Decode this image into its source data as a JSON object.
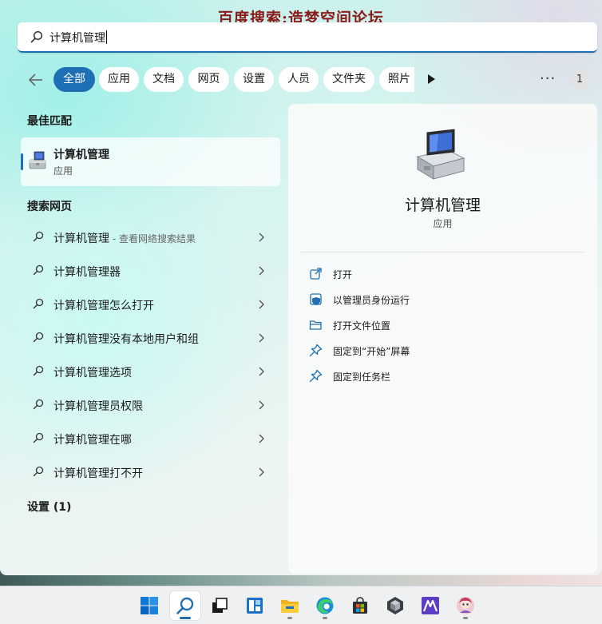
{
  "watermark": "百度搜索:造梦空间论坛",
  "search": {
    "value": "计算机管理"
  },
  "filters": {
    "tabs": [
      {
        "label": "全部",
        "active": true
      },
      {
        "label": "应用"
      },
      {
        "label": "文档"
      },
      {
        "label": "网页"
      },
      {
        "label": "设置"
      },
      {
        "label": "人员"
      },
      {
        "label": "文件夹"
      },
      {
        "label": "照片"
      }
    ],
    "more": "···",
    "badge": "1"
  },
  "best_match": {
    "heading": "最佳匹配",
    "name": "计算机管理",
    "type": "应用"
  },
  "web": {
    "heading": "搜索网页",
    "items": [
      {
        "label": "计算机管理",
        "sub": " - 查看网络搜索结果"
      },
      {
        "label": "计算机管理器"
      },
      {
        "label": "计算机管理怎么打开"
      },
      {
        "label": "计算机管理没有本地用户和组"
      },
      {
        "label": "计算机管理选项"
      },
      {
        "label": "计算机管理员权限"
      },
      {
        "label": "计算机管理在哪"
      },
      {
        "label": "计算机管理打不开"
      }
    ]
  },
  "settings_heading": "设置 (1)",
  "preview": {
    "name": "计算机管理",
    "type": "应用",
    "actions": [
      {
        "label": "打开",
        "icon": "open-external-icon"
      },
      {
        "label": "以管理员身份运行",
        "icon": "shield-admin-icon"
      },
      {
        "label": "打开文件位置",
        "icon": "folder-open-icon"
      },
      {
        "label": "固定到“开始”屏幕",
        "icon": "pin-icon"
      },
      {
        "label": "固定到任务栏",
        "icon": "pin-icon"
      }
    ]
  },
  "colors": {
    "accent": "#1f6fb4",
    "watermark": "#8b1a1a"
  },
  "taskbar": {
    "icons": [
      "windows-start-icon",
      "search-icon",
      "task-view-icon",
      "widgets-icon",
      "file-explorer-icon",
      "edge-browser-icon",
      "store-icon",
      "cube-app-icon",
      "media-app-icon",
      "avatar-app-icon"
    ]
  }
}
